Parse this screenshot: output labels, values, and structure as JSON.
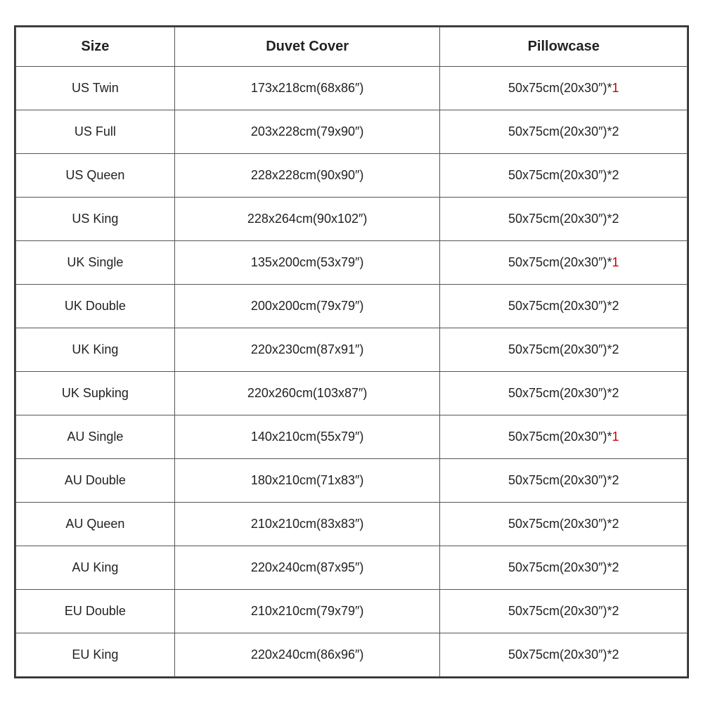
{
  "table": {
    "headers": [
      "Size",
      "Duvet Cover",
      "Pillowcase"
    ],
    "rows": [
      {
        "size": "US Twin",
        "duvet": "173x218cm(68x86″)",
        "pillow_base": "50x75cm(20x30″)*",
        "pillow_count": "1",
        "pillow_red": true
      },
      {
        "size": "US Full",
        "duvet": "203x228cm(79x90″)",
        "pillow_base": "50x75cm(20x30″)*",
        "pillow_count": "2",
        "pillow_red": false
      },
      {
        "size": "US Queen",
        "duvet": "228x228cm(90x90″)",
        "pillow_base": "50x75cm(20x30″)*",
        "pillow_count": "2",
        "pillow_red": false
      },
      {
        "size": "US King",
        "duvet": "228x264cm(90x102″)",
        "pillow_base": "50x75cm(20x30″)*",
        "pillow_count": "2",
        "pillow_red": false
      },
      {
        "size": "UK Single",
        "duvet": "135x200cm(53x79″)",
        "pillow_base": "50x75cm(20x30″)*",
        "pillow_count": "1",
        "pillow_red": true
      },
      {
        "size": "UK Double",
        "duvet": "200x200cm(79x79″)",
        "pillow_base": "50x75cm(20x30″)*",
        "pillow_count": "2",
        "pillow_red": false
      },
      {
        "size": "UK King",
        "duvet": "220x230cm(87x91″)",
        "pillow_base": "50x75cm(20x30″)*",
        "pillow_count": "2",
        "pillow_red": false
      },
      {
        "size": "UK Supking",
        "duvet": "220x260cm(103x87″)",
        "pillow_base": "50x75cm(20x30″)*",
        "pillow_count": "2",
        "pillow_red": false
      },
      {
        "size": "AU Single",
        "duvet": "140x210cm(55x79″)",
        "pillow_base": "50x75cm(20x30″)*",
        "pillow_count": "1",
        "pillow_red": true
      },
      {
        "size": "AU Double",
        "duvet": "180x210cm(71x83″)",
        "pillow_base": "50x75cm(20x30″)*",
        "pillow_count": "2",
        "pillow_red": false
      },
      {
        "size": "AU Queen",
        "duvet": "210x210cm(83x83″)",
        "pillow_base": "50x75cm(20x30″)*",
        "pillow_count": "2",
        "pillow_red": false
      },
      {
        "size": "AU King",
        "duvet": "220x240cm(87x95″)",
        "pillow_base": "50x75cm(20x30″)*",
        "pillow_count": "2",
        "pillow_red": false
      },
      {
        "size": "EU Double",
        "duvet": "210x210cm(79x79″)",
        "pillow_base": "50x75cm(20x30″)*",
        "pillow_count": "2",
        "pillow_red": false
      },
      {
        "size": "EU King",
        "duvet": "220x240cm(86x96″)",
        "pillow_base": "50x75cm(20x30″)*",
        "pillow_count": "2",
        "pillow_red": false
      }
    ]
  }
}
